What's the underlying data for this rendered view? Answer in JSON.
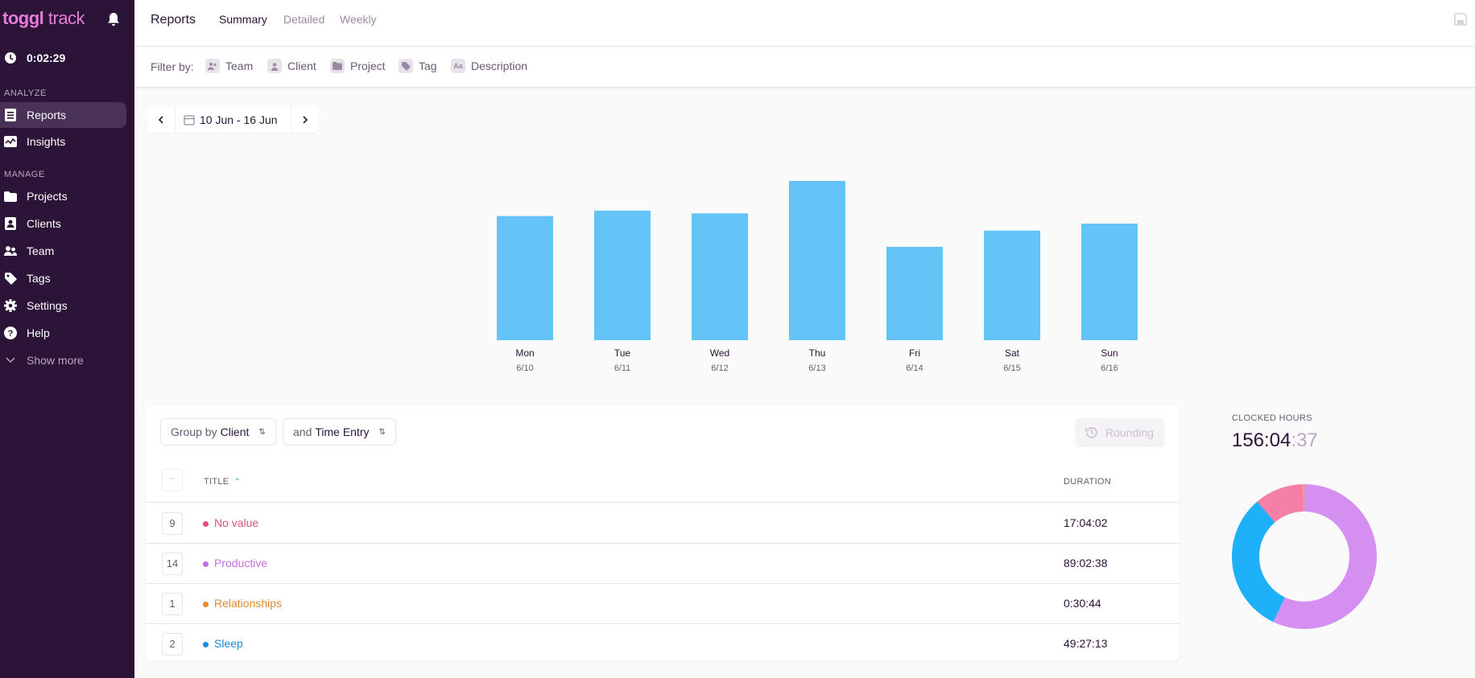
{
  "app": {
    "logo_bold": "toggl",
    "logo_light": " track",
    "timer": "0:02:29"
  },
  "sidebar": {
    "analyze_label": "ANALYZE",
    "manage_label": "MANAGE",
    "items": [
      {
        "label": "Reports",
        "icon": "reports-icon"
      },
      {
        "label": "Insights",
        "icon": "insights-icon"
      },
      {
        "label": "Projects",
        "icon": "folder-icon"
      },
      {
        "label": "Clients",
        "icon": "client-icon"
      },
      {
        "label": "Team",
        "icon": "team-icon"
      },
      {
        "label": "Tags",
        "icon": "tag-icon"
      },
      {
        "label": "Settings",
        "icon": "gear-icon"
      },
      {
        "label": "Help",
        "icon": "help-icon"
      },
      {
        "label": "Show more",
        "icon": "chevron-down-icon"
      }
    ]
  },
  "header": {
    "title": "Reports",
    "tabs": [
      "Summary",
      "Detailed",
      "Weekly"
    ]
  },
  "filters": {
    "label": "Filter by:",
    "items": [
      "Team",
      "Client",
      "Project",
      "Tag",
      "Description"
    ]
  },
  "date_range": "10 Jun - 16 Jun",
  "chart_data": {
    "type": "bar",
    "categories": [
      "Mon",
      "Tue",
      "Wed",
      "Thu",
      "Fri",
      "Sat",
      "Sun"
    ],
    "sub_labels": [
      "6/10",
      "6/11",
      "6/12",
      "6/13",
      "6/14",
      "6/15",
      "6/16"
    ],
    "values": [
      23.0,
      24.0,
      23.5,
      29.5,
      17.3,
      20.3,
      21.6
    ],
    "color": "#64c4f7",
    "grid": false
  },
  "table": {
    "group_prefix": "Group by",
    "group_value": "Client",
    "sub_prefix": "and",
    "sub_value": "Time Entry",
    "rounding_label": "Rounding",
    "count_header": "--",
    "title_header": "TITLE",
    "duration_header": "DURATION",
    "rows": [
      {
        "count": "9",
        "title": "No value",
        "duration": "17:04:02",
        "color": "#e0517c"
      },
      {
        "count": "14",
        "title": "Productive",
        "duration": "89:02:38",
        "color": "#c46ee0"
      },
      {
        "count": "1",
        "title": "Relationships",
        "duration": "0:30:44",
        "color": "#e58a2e"
      },
      {
        "count": "2",
        "title": "Sleep",
        "duration": "49:27:13",
        "color": "#1f8ad6"
      }
    ]
  },
  "summary": {
    "clocked_label": "CLOCKED HOURS",
    "clocked_main": "156:04",
    "clocked_sec": ":37"
  },
  "donut": {
    "segments": [
      {
        "name": "Productive",
        "value": 89.04,
        "color": "#d48ff0"
      },
      {
        "name": "Sleep",
        "value": 49.45,
        "color": "#1fb0fa"
      },
      {
        "name": "No value",
        "value": 17.07,
        "color": "#f57fa6"
      },
      {
        "name": "Relationships",
        "value": 0.51,
        "color": "#f5a04a"
      }
    ]
  }
}
